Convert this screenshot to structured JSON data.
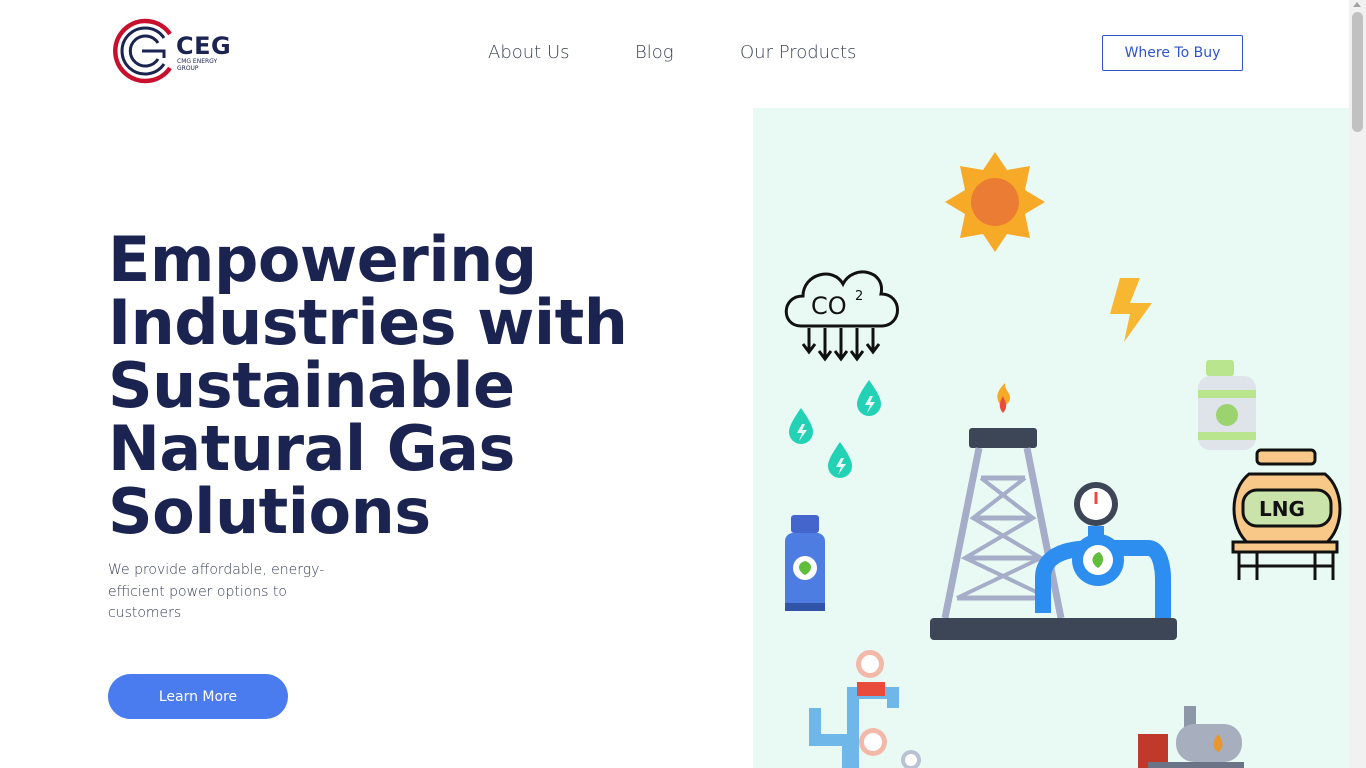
{
  "brand": {
    "name": "CEG",
    "tagline": "CMG ENERGY GROUP",
    "colors": {
      "red": "#c8102e",
      "navy": "#1b2350"
    }
  },
  "nav": {
    "items": [
      {
        "label": "About Us"
      },
      {
        "label": "Blog"
      },
      {
        "label": "Our Products"
      }
    ],
    "cta_label": "Where To Buy"
  },
  "hero": {
    "title": "Empowering Industries with Sustainable Natural Gas Solutions",
    "subtitle": "We provide affordable, energy-efficient power options to customers",
    "button_label": "Learn More"
  },
  "illustration": {
    "co2_label": "CO",
    "co2_sup": "2",
    "lng_label": "LNG",
    "icons": [
      "sun-icon",
      "co2-cloud-icon",
      "lightning-icon",
      "water-drop-icon",
      "gas-cylinder-icon",
      "gas-rig-icon",
      "pressure-gauge-icon",
      "lng-tank-icon",
      "pipes-icon",
      "tanker-truck-icon"
    ]
  },
  "theme": {
    "accent": "#4a7cf0",
    "illustration_bg": "#e9faf4"
  }
}
